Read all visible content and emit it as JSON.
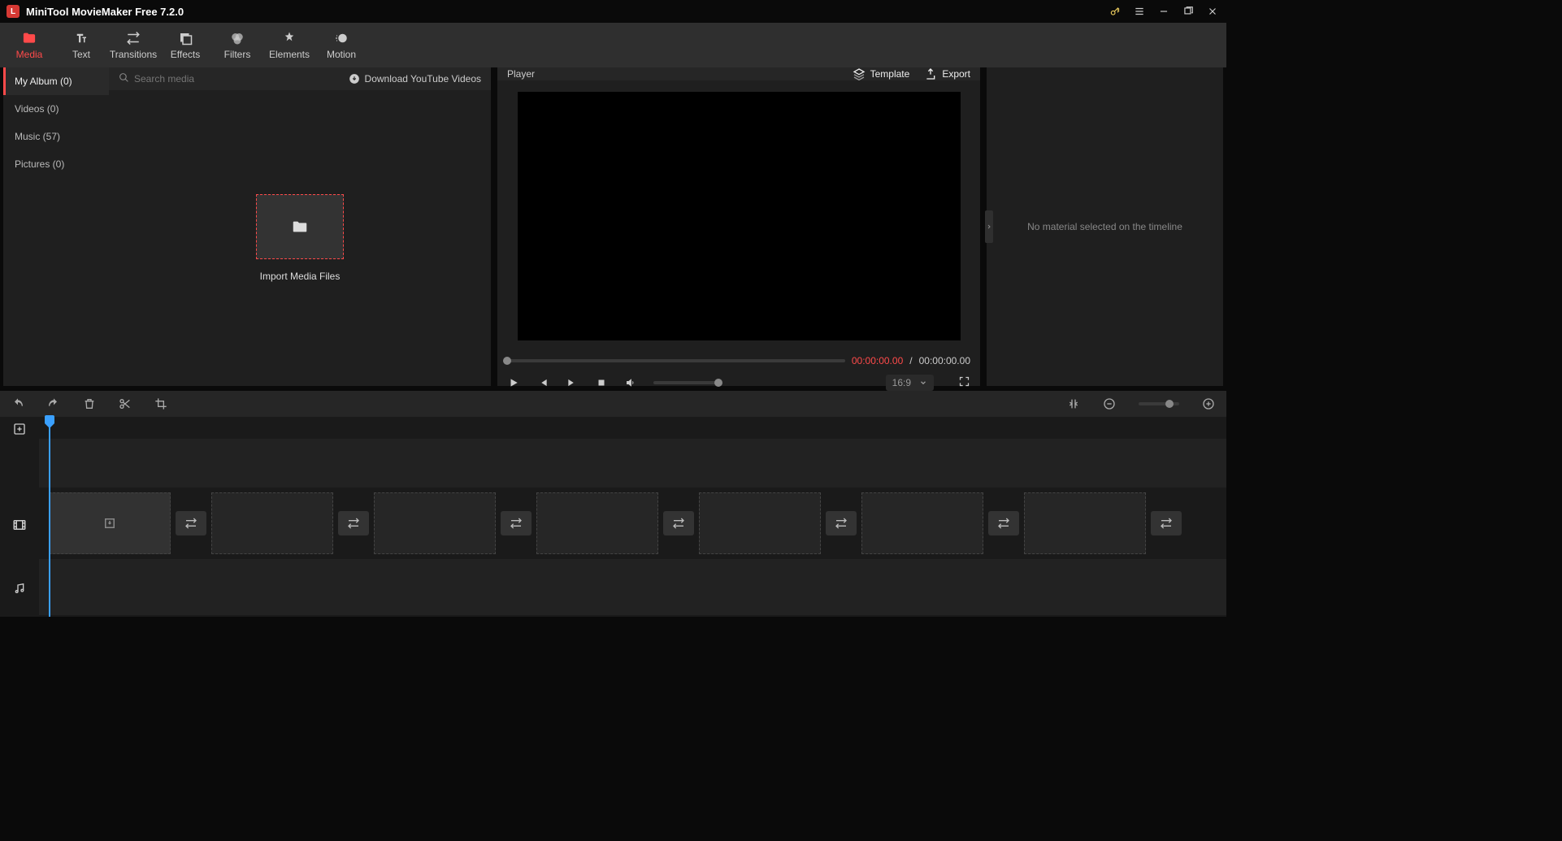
{
  "title": "MiniTool MovieMaker Free 7.2.0",
  "tabs": {
    "media": "Media",
    "text": "Text",
    "transitions": "Transitions",
    "effects": "Effects",
    "filters": "Filters",
    "elements": "Elements",
    "motion": "Motion"
  },
  "sidebar": {
    "my_album": "My Album (0)",
    "videos": "Videos (0)",
    "music": "Music (57)",
    "pictures": "Pictures (0)"
  },
  "search": {
    "placeholder": "Search media"
  },
  "yt_link": "Download YouTube Videos",
  "import_label": "Import Media Files",
  "player": {
    "title": "Player",
    "template": "Template",
    "export": "Export",
    "time_current": "00:00:00.00",
    "time_sep": " / ",
    "time_total": "00:00:00.00",
    "aspect": "16:9"
  },
  "right_panel": {
    "empty": "No material selected on the timeline"
  }
}
